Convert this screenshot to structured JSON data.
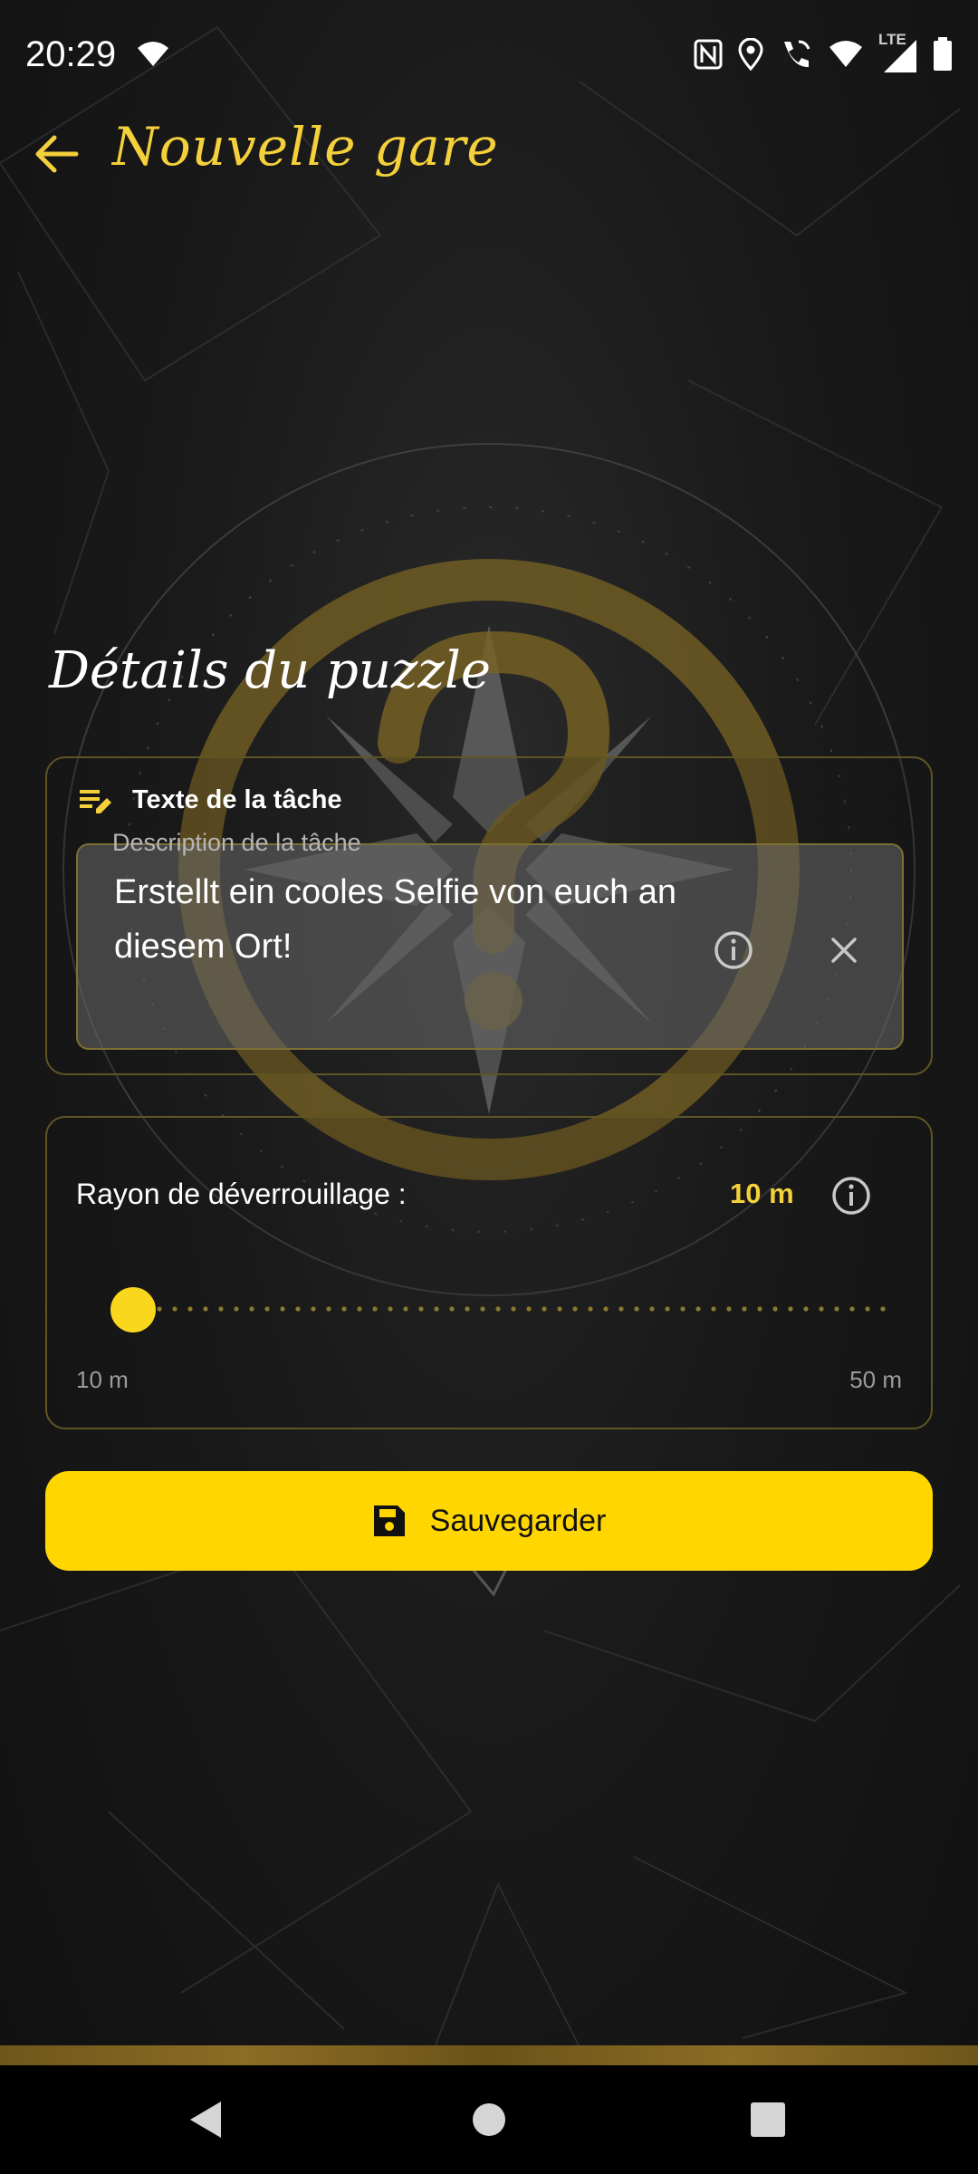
{
  "status_bar": {
    "time": "20:29",
    "network": "LTE",
    "icons": [
      "wifi-icon",
      "nfc-icon",
      "location-icon",
      "wifi-calling-icon",
      "wifi-icon",
      "signal-icon",
      "battery-icon"
    ]
  },
  "app_bar": {
    "title": "Nouvelle gare",
    "back_icon": "arrow-back-icon"
  },
  "section_title": "Détails du puzzle",
  "task": {
    "header_icon": "edit-note-icon",
    "header_label": "Texte de la tâche",
    "field_label": "Description de la tâche",
    "field_value": "Erstellt ein cooles Selfie von euch an diesem Ort!",
    "info_icon": "info-icon",
    "clear_icon": "close-icon"
  },
  "radius": {
    "label": "Rayon de déverrouillage :",
    "value_text": "10 m",
    "value": 10,
    "min": 10,
    "max": 50,
    "min_label": "10 m",
    "max_label": "50 m",
    "info_icon": "info-icon"
  },
  "save_button": {
    "label": "Sauvegarder",
    "icon": "save-icon"
  },
  "nav": {
    "icons": [
      "nav-back-icon",
      "nav-home-icon",
      "nav-recents-icon"
    ]
  },
  "colors": {
    "accent": "#f4d03a",
    "button": "#ffd600",
    "background": "#151515",
    "card_border": "#5f5523"
  }
}
